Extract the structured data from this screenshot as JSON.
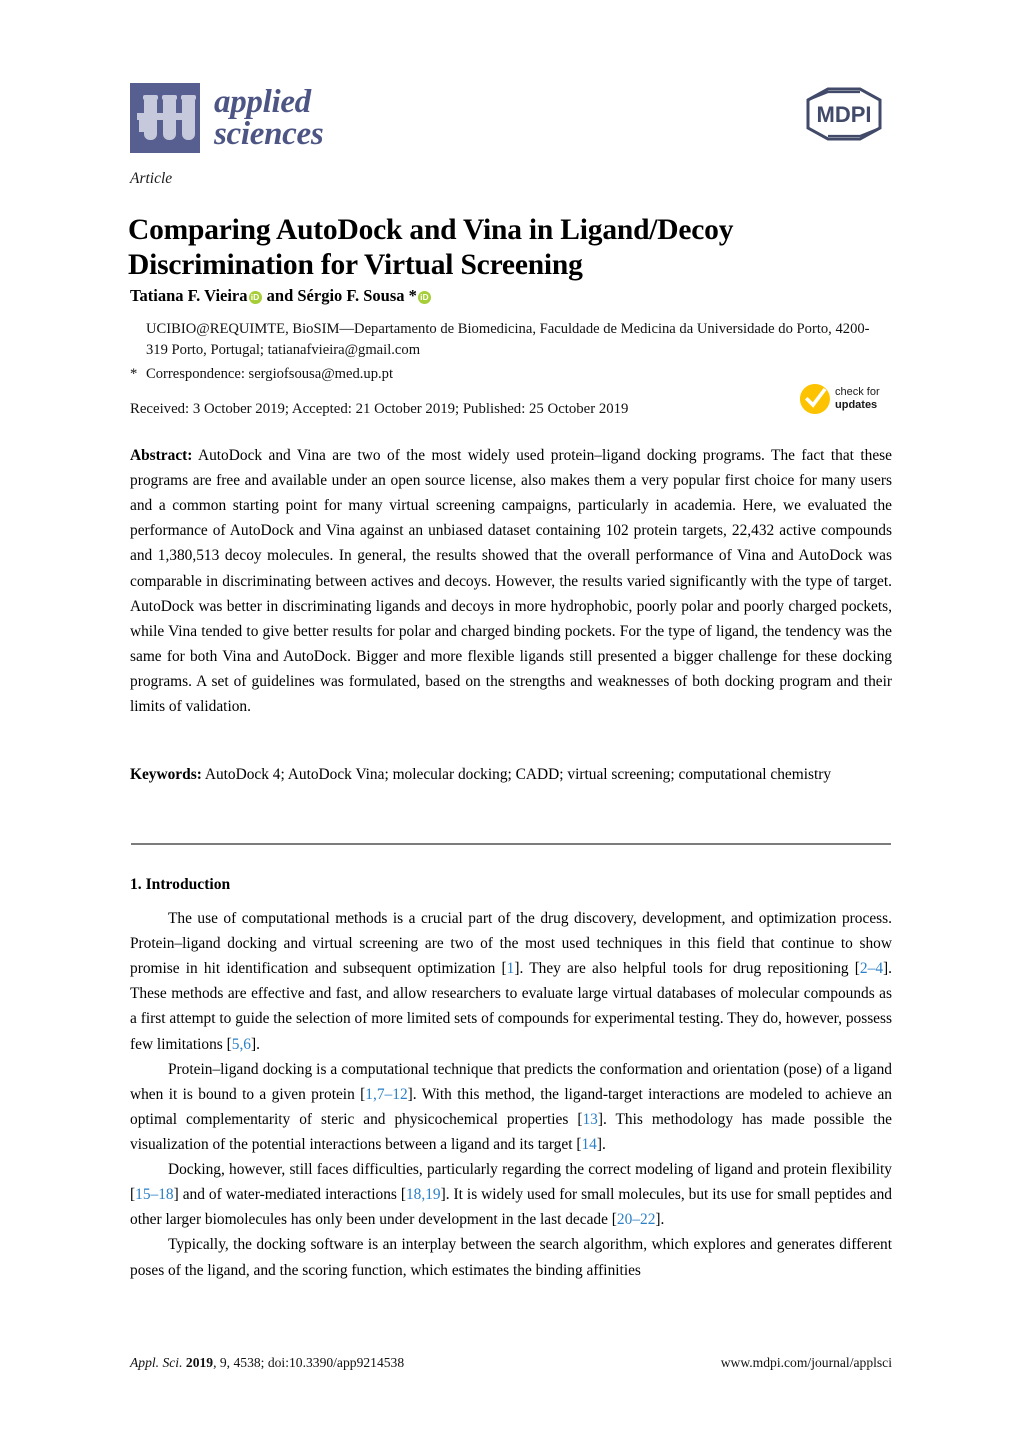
{
  "journal": {
    "name_line1": "applied",
    "name_line2": "sciences",
    "publisher": "MDPI",
    "logo_color": "#575f90",
    "name_color": "#4d5585"
  },
  "article": {
    "type": "Article",
    "title": "Comparing AutoDock and Vina in Ligand/Decoy Discrimination for Virtual Screening"
  },
  "authors": {
    "line": "Tatiana F. Vieira  and Sérgio F. Sousa *",
    "author1": "Tatiana F. Vieira",
    "connector": " and ",
    "author2": "Sérgio F. Sousa ",
    "corresponding_marker": "*",
    "orcid_label": "iD",
    "orcid_color": "#a6ce39"
  },
  "affiliation": {
    "text": "UCIBIO@REQUIMTE, BioSIM—Departamento de Biomedicina, Faculdade de Medicina da Universidade do Porto, 4200-319 Porto, Portugal; tatianafvieira@gmail.com",
    "correspondence_marker": "*",
    "correspondence": "Correspondence: sergiofsousa@med.up.pt"
  },
  "dates": {
    "line": "Received: 3 October 2019; Accepted: 21 October 2019; Published: 25 October 2019"
  },
  "check_for_updates": {
    "line1": "check for",
    "line2": "updates",
    "badge_color": "#fdc300"
  },
  "abstract": {
    "label": "Abstract:",
    "text": " AutoDock and Vina are two of the most widely used protein–ligand docking programs. The fact that these programs are free and available under an open source license, also makes them a very popular first choice for many users and a common starting point for many virtual screening campaigns, particularly in academia. Here, we evaluated the performance of AutoDock and Vina against an unbiased dataset containing 102 protein targets, 22,432 active compounds and 1,380,513 decoy molecules. In general, the results showed that the overall performance of Vina and AutoDock was comparable in discriminating between actives and decoys. However, the results varied significantly with the type of target. AutoDock was better in discriminating ligands and decoys in more hydrophobic, poorly polar and poorly charged pockets, while Vina tended to give better results for polar and charged binding pockets. For the type of ligand, the tendency was the same for both Vina and AutoDock. Bigger and more flexible ligands still presented a bigger challenge for these docking programs. A set of guidelines was formulated, based on the strengths and weaknesses of both docking program and their limits of validation."
  },
  "keywords": {
    "label": "Keywords:",
    "text": " AutoDock 4; AutoDock Vina; molecular docking; CADD; virtual screening; computational chemistry"
  },
  "introduction": {
    "heading": "1. Introduction",
    "paragraphs": [
      {
        "segments": [
          {
            "t": "The use of computational methods is a crucial part of the drug discovery, development, and optimization process. Protein–ligand docking and virtual screening are two of the most used techniques in this field that continue to show promise in hit identification and subsequent optimization [",
            "c": false
          },
          {
            "t": "1",
            "c": true
          },
          {
            "t": "]. They are also helpful tools for drug repositioning [",
            "c": false
          },
          {
            "t": "2",
            "c": true
          },
          {
            "t": "–",
            "c": true
          },
          {
            "t": "4",
            "c": true
          },
          {
            "t": "]. These methods are effective and fast, and allow researchers to evaluate large virtual databases of molecular compounds as a first attempt to guide the selection of more limited sets of compounds for experimental testing. They do, however, possess few limitations [",
            "c": false
          },
          {
            "t": "5",
            "c": true
          },
          {
            "t": ",",
            "c": true
          },
          {
            "t": "6",
            "c": true
          },
          {
            "t": "].",
            "c": false
          }
        ]
      },
      {
        "segments": [
          {
            "t": "Protein–ligand docking is a computational technique that predicts the conformation and orientation (pose) of a ligand when it is bound to a given protein [",
            "c": false
          },
          {
            "t": "1",
            "c": true
          },
          {
            "t": ",",
            "c": true
          },
          {
            "t": "7",
            "c": true
          },
          {
            "t": "–",
            "c": true
          },
          {
            "t": "12",
            "c": true
          },
          {
            "t": "]. With this method, the ligand-target interactions are modeled to achieve an optimal complementarity of steric and physicochemical properties [",
            "c": false
          },
          {
            "t": "13",
            "c": true
          },
          {
            "t": "]. This methodology has made possible the visualization of the potential interactions between a ligand and its target [",
            "c": false
          },
          {
            "t": "14",
            "c": true
          },
          {
            "t": "].",
            "c": false
          }
        ]
      },
      {
        "segments": [
          {
            "t": "Docking, however, still faces difficulties, particularly regarding the correct modeling of ligand and protein flexibility [",
            "c": false
          },
          {
            "t": "15",
            "c": true
          },
          {
            "t": "–",
            "c": true
          },
          {
            "t": "18",
            "c": true
          },
          {
            "t": "] and of water-mediated interactions [",
            "c": false
          },
          {
            "t": "18",
            "c": true
          },
          {
            "t": ",",
            "c": true
          },
          {
            "t": "19",
            "c": true
          },
          {
            "t": "].  It is widely used for small molecules, but its use for small peptides and other larger biomolecules has only been under development in the last decade [",
            "c": false
          },
          {
            "t": "20",
            "c": true
          },
          {
            "t": "–",
            "c": true
          },
          {
            "t": "22",
            "c": true
          },
          {
            "t": "].",
            "c": false
          }
        ]
      },
      {
        "segments": [
          {
            "t": "Typically, the docking software is an interplay between the search algorithm, which explores and generates different poses of the ligand, and the scoring function, which estimates the binding affinities",
            "c": false
          }
        ]
      }
    ]
  },
  "footer": {
    "citation_prefix": "Appl. Sci.",
    "citation_year": "2019",
    "citation_rest": ", 9, 4538; doi:10.3390/app9214538",
    "url": "www.mdpi.com/journal/applsci"
  }
}
